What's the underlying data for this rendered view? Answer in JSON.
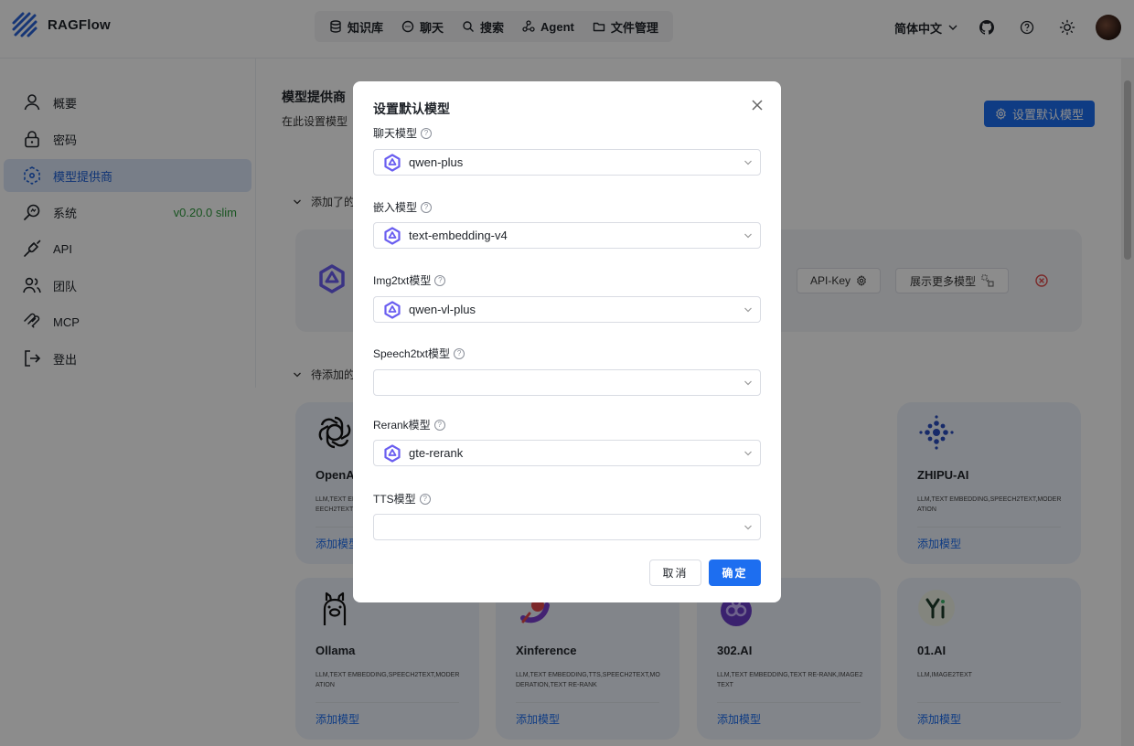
{
  "app": {
    "name": "RAGFlow"
  },
  "nav": {
    "items": [
      {
        "label": "知识库",
        "icon": "database-icon"
      },
      {
        "label": "聊天",
        "icon": "chat-bubble-icon"
      },
      {
        "label": "搜索",
        "icon": "search-icon"
      },
      {
        "label": "Agent",
        "icon": "agent-graph-icon"
      },
      {
        "label": "文件管理",
        "icon": "folder-icon"
      }
    ]
  },
  "header": {
    "language": "简体中文"
  },
  "sidebar": {
    "items": [
      {
        "label": "概要",
        "icon": "user-icon"
      },
      {
        "label": "密码",
        "icon": "lock-icon"
      },
      {
        "label": "模型提供商",
        "icon": "model-provider-icon"
      },
      {
        "label": "系统",
        "icon": "system-icon"
      },
      {
        "label": "API",
        "icon": "plug-icon"
      },
      {
        "label": "团队",
        "icon": "team-icon"
      },
      {
        "label": "MCP",
        "icon": "mcp-icon"
      },
      {
        "label": "登出",
        "icon": "logout-icon"
      }
    ],
    "version": "v0.20.0 slim"
  },
  "main": {
    "title": "模型提供商",
    "subtitle": "在此设置模型",
    "set_default_button": "设置默认模型",
    "added_section": "添加了的",
    "pending_section": "待添加的",
    "added_card": {
      "api_key_button": "API-Key",
      "more_models_button": "展示更多模型"
    },
    "providers": [
      {
        "name": "OpenAI",
        "tags": "LLM,TEXT EMBEDDING,TTS,TEXT RE-RANK,SPEECH2TEXT",
        "add": "添加模型"
      },
      {
        "name": "ZHIPU-AI",
        "tags": "LLM,TEXT EMBEDDING,SPEECH2TEXT,MODERATION",
        "add": "添加模型"
      },
      {
        "name": "Ollama",
        "tags": "LLM,TEXT EMBEDDING,SPEECH2TEXT,MODERATION",
        "add": "添加模型"
      },
      {
        "name": "Xinference",
        "tags": "LLM,TEXT EMBEDDING,TTS,SPEECH2TEXT,MODERATION,TEXT RE-RANK",
        "add": "添加模型"
      },
      {
        "name": "302.AI",
        "tags": "LLM,TEXT EMBEDDING,TEXT RE-RANK,IMAGE2TEXT",
        "add": "添加模型"
      },
      {
        "name": "01.AI",
        "tags": "LLM,IMAGE2TEXT",
        "add": "添加模型"
      }
    ]
  },
  "modal": {
    "title": "设置默认模型",
    "fields": [
      {
        "label": "聊天模型",
        "value": "qwen-plus"
      },
      {
        "label": "嵌入模型",
        "value": "text-embedding-v4"
      },
      {
        "label": "Img2txt模型",
        "value": "qwen-vl-plus"
      },
      {
        "label": "Speech2txt模型",
        "value": ""
      },
      {
        "label": "Rerank模型",
        "value": "gte-rerank"
      },
      {
        "label": "TTS模型",
        "value": ""
      }
    ],
    "cancel": "取消",
    "ok": "确定"
  },
  "colors": {
    "primary": "#1d6ef0",
    "active_bg": "#dbe6f8",
    "version_green": "#2e9a3d",
    "card_bg": "#edf2fb",
    "qwen": "#6a5ef0"
  }
}
